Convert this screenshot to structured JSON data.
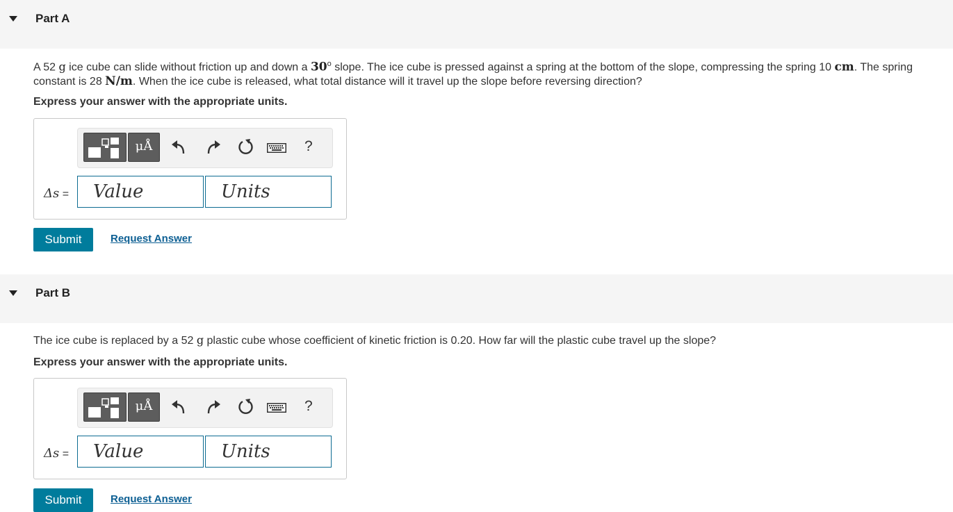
{
  "parts": [
    {
      "title": "Part A",
      "problem": {
        "text1": "A 52 ",
        "unit_g": "g",
        "text2": " ice cube can slide without friction up and down a ",
        "angle": "30",
        "degree": "o",
        "text3": " slope. The ice cube is pressed against a spring at the bottom of the slope, compressing the spring 10 ",
        "unit_cm": "cm",
        "text4": ". The spring",
        "line2_text1": "constant is 28 ",
        "unit_nm": "N/m",
        "line2_text2": ". When the ice cube is released, what total distance will it travel up the slope before reversing direction?"
      },
      "instruction": "Express your answer with the appropriate units.",
      "answer": {
        "label_sym": "Δs",
        "label_eq": " =",
        "value_placeholder": "Value",
        "units_placeholder": "Units",
        "units_button_glyph": "μÅ",
        "help_glyph": "?"
      },
      "submit_label": "Submit",
      "request_label": "Request Answer"
    },
    {
      "title": "Part B",
      "problem": {
        "text1": "The ice cube is replaced by a 52 ",
        "unit_g": "g",
        "text2": " plastic cube whose coefficient of kinetic friction is 0.20. How far will the plastic cube travel up the slope?"
      },
      "instruction": "Express your answer with the appropriate units.",
      "answer": {
        "label_sym": "Δs",
        "label_eq": " =",
        "value_placeholder": "Value",
        "units_placeholder": "Units",
        "units_button_glyph": "μÅ",
        "help_glyph": "?"
      },
      "submit_label": "Submit",
      "request_label": "Request Answer"
    }
  ],
  "icons": [
    "collapse-triangle-icon",
    "templates-icon",
    "units-icon",
    "undo-icon",
    "redo-icon",
    "reset-icon",
    "keyboard-icon",
    "help-icon"
  ],
  "colors": {
    "accent": "#007c9c",
    "link": "#0d5f93",
    "header_bg": "#f5f5f5",
    "field_border": "#0c6b91"
  }
}
